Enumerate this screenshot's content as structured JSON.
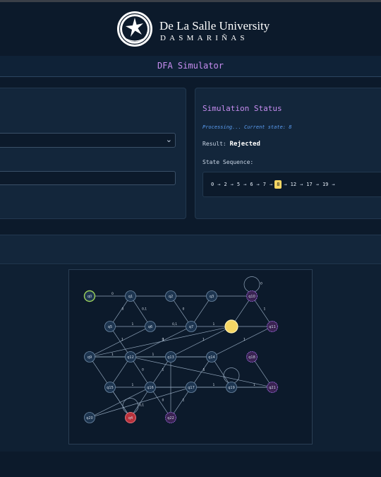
{
  "header": {
    "university_name": "De La Salle University",
    "campus": "DASMARIÑAS"
  },
  "page": {
    "title": "DFA Simulator"
  },
  "status": {
    "title": "Simulation Status",
    "processing_text": "Processing... Current state: 8",
    "result_label": "Result:",
    "result_value": "Rejected",
    "sequence_label": "State Sequence:",
    "sequence": [
      "0",
      "2",
      "5",
      "6",
      "7",
      "8",
      "12",
      "17",
      "19"
    ],
    "current_index": 5
  },
  "controls": {
    "select_value": "",
    "input_value": ""
  },
  "colors": {
    "accent": "#c78df0",
    "current_state": "#f5d664",
    "start_state": "#9bd15a",
    "dead_state": "#b8323c",
    "final_state": "#9f6ae0",
    "node_fill": "#1d3550"
  },
  "graph": {
    "nodes": [
      {
        "id": "q0",
        "label": "q0",
        "type": "start"
      },
      {
        "id": "q1",
        "label": "q1",
        "type": "normal"
      },
      {
        "id": "q2",
        "label": "q2",
        "type": "normal"
      },
      {
        "id": "q3",
        "label": "q3",
        "type": "normal"
      },
      {
        "id": "q10",
        "label": "q10",
        "type": "final"
      },
      {
        "id": "q5",
        "label": "q5",
        "type": "normal"
      },
      {
        "id": "q6",
        "label": "q6",
        "type": "normal"
      },
      {
        "id": "q7",
        "label": "q7",
        "type": "normal"
      },
      {
        "id": "q8",
        "label": "",
        "type": "current"
      },
      {
        "id": "q11",
        "label": "q11",
        "type": "final"
      },
      {
        "id": "q9",
        "label": "q9",
        "type": "normal"
      },
      {
        "id": "q12",
        "label": "q12",
        "type": "normal"
      },
      {
        "id": "q13",
        "label": "q13",
        "type": "normal"
      },
      {
        "id": "q14",
        "label": "q14",
        "type": "normal"
      },
      {
        "id": "q18",
        "label": "q18",
        "type": "final"
      },
      {
        "id": "q15",
        "label": "q15",
        "type": "normal"
      },
      {
        "id": "q16",
        "label": "q16",
        "type": "normal"
      },
      {
        "id": "q17",
        "label": "q17",
        "type": "normal"
      },
      {
        "id": "q19",
        "label": "q19",
        "type": "normal"
      },
      {
        "id": "q21",
        "label": "q21",
        "type": "final"
      },
      {
        "id": "q20",
        "label": "q20",
        "type": "normal"
      },
      {
        "id": "q4",
        "label": "q4",
        "type": "dead"
      },
      {
        "id": "q22",
        "label": "q22",
        "type": "final"
      }
    ],
    "edges": [
      {
        "from": "q0",
        "to": "q1",
        "label": "0"
      },
      {
        "from": "q1",
        "to": "q2",
        "label": ""
      },
      {
        "from": "q2",
        "to": "q3",
        "label": ""
      },
      {
        "from": "q3",
        "to": "q10",
        "label": ""
      },
      {
        "from": "q10",
        "to": "q10",
        "label": "0"
      },
      {
        "from": "q10",
        "to": "q11",
        "label": "1"
      },
      {
        "from": "q1",
        "to": "q5",
        "label": "0"
      },
      {
        "from": "q1",
        "to": "q6",
        "label": "0,1"
      },
      {
        "from": "q2",
        "to": "q7",
        "label": "0"
      },
      {
        "from": "q3",
        "to": "q7",
        "label": ""
      },
      {
        "from": "q5",
        "to": "q6",
        "label": "1"
      },
      {
        "from": "q6",
        "to": "q7",
        "label": "0,1"
      },
      {
        "from": "q7",
        "to": "q8",
        "label": "1"
      },
      {
        "from": "q8",
        "to": "q11",
        "label": ""
      },
      {
        "from": "q8",
        "to": "q10",
        "label": ""
      },
      {
        "from": "q5",
        "to": "q12",
        "label": ""
      },
      {
        "from": "q6",
        "to": "q9",
        "label": "1"
      },
      {
        "from": "q7",
        "to": "q12",
        "label": "1"
      },
      {
        "from": "q8",
        "to": "q9",
        "label": "0"
      },
      {
        "from": "q9",
        "to": "q12",
        "label": "1"
      },
      {
        "from": "q9",
        "to": "q13",
        "label": "0"
      },
      {
        "from": "q9",
        "to": "q14",
        "label": "1"
      },
      {
        "from": "q12",
        "to": "q13",
        "label": ""
      },
      {
        "from": "q13",
        "to": "q14",
        "label": ""
      },
      {
        "from": "q8",
        "to": "q13",
        "label": "1"
      },
      {
        "from": "q11",
        "to": "q14",
        "label": "1"
      },
      {
        "from": "q12",
        "to": "q16",
        "label": "0"
      },
      {
        "from": "q12",
        "to": "q15",
        "label": ""
      },
      {
        "from": "q13",
        "to": "q16",
        "label": "1"
      },
      {
        "from": "q14",
        "to": "q17",
        "label": "1"
      },
      {
        "from": "q14",
        "to": "q19",
        "label": ""
      },
      {
        "from": "q15",
        "to": "q16",
        "label": "1"
      },
      {
        "from": "q16",
        "to": "q17",
        "label": ""
      },
      {
        "from": "q17",
        "to": "q19",
        "label": "1"
      },
      {
        "from": "q19",
        "to": "q19",
        "label": ""
      },
      {
        "from": "q19",
        "to": "q21",
        "label": "1"
      },
      {
        "from": "q16",
        "to": "q21",
        "label": ""
      },
      {
        "from": "q18",
        "to": "q21",
        "label": ""
      },
      {
        "from": "q15",
        "to": "q4",
        "label": ""
      },
      {
        "from": "q16",
        "to": "q4",
        "label": ""
      },
      {
        "from": "q4",
        "to": "q4",
        "label": "0,1"
      },
      {
        "from": "q20",
        "to": "q16",
        "label": ""
      },
      {
        "from": "q20",
        "to": "q17",
        "label": ""
      },
      {
        "from": "q17",
        "to": "q22",
        "label": "1"
      },
      {
        "from": "q16",
        "to": "q22",
        "label": "0"
      },
      {
        "from": "q13",
        "to": "q22",
        "label": ""
      },
      {
        "from": "q9",
        "to": "q4",
        "label": ""
      },
      {
        "from": "q12",
        "to": "q21",
        "label": "1"
      }
    ]
  }
}
